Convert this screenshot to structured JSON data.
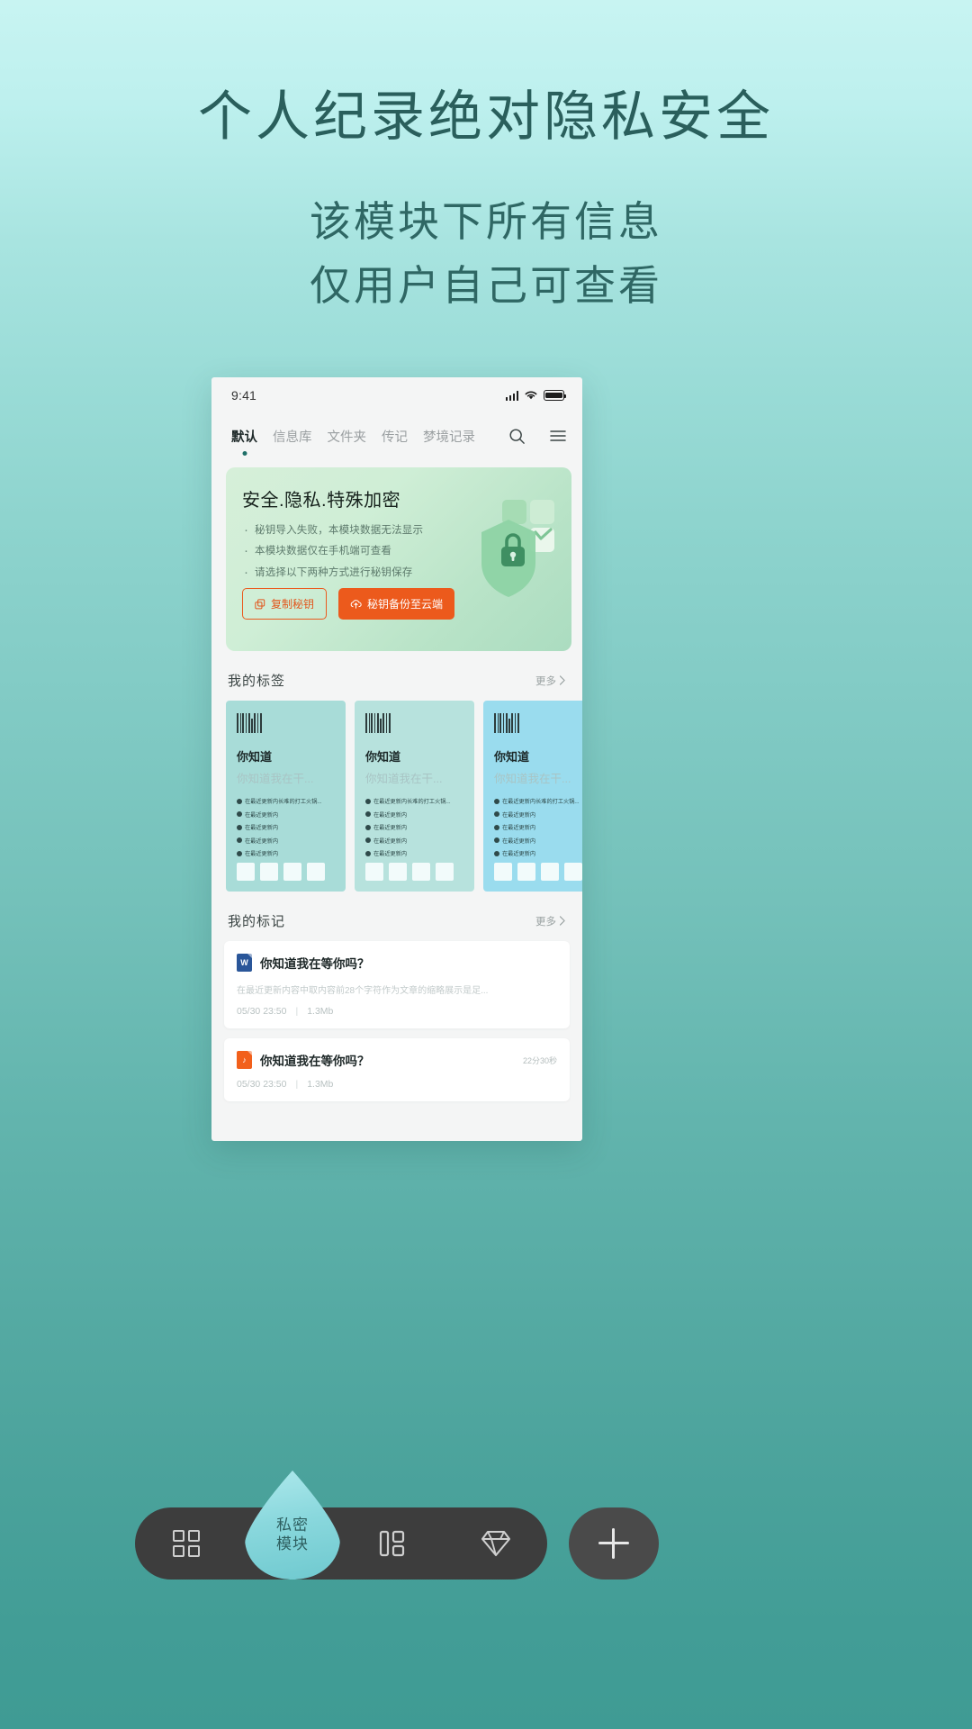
{
  "hero": {
    "title": "个人纪录绝对隐私安全",
    "subtitle_line1": "该模块下所有信息",
    "subtitle_line2": "仅用户自己可查看"
  },
  "phone": {
    "status": {
      "time": "9:41",
      "signal_icon": "signal-bars-icon",
      "wifi_icon": "wifi-icon",
      "battery_icon": "battery-icon"
    },
    "tabs": [
      {
        "label": "默认",
        "active": true
      },
      {
        "label": "信息库",
        "active": false
      },
      {
        "label": "文件夹",
        "active": false
      },
      {
        "label": "传记",
        "active": false
      },
      {
        "label": "梦境记录",
        "active": false
      }
    ],
    "tab_actions": {
      "search_icon": "search-icon",
      "menu_icon": "hamburger-menu-icon"
    },
    "encryption_card": {
      "title": "安全.隐私.特殊加密",
      "bullets": [
        "秘钥导入失败，本模块数据无法显示",
        "本模块数据仅在手机端可查看",
        "请选择以下两种方式进行秘钥保存"
      ],
      "copy_button": {
        "label": "复制秘钥",
        "icon": "copy-icon"
      },
      "backup_button": {
        "label": "秘钥备份至云端",
        "icon": "cloud-upload-icon"
      },
      "illustration": "shield-lock-icon",
      "accent_color": "#ec5a1c",
      "card_bg": "#cfeed6"
    },
    "tags_section": {
      "title": "我的标签",
      "more_label": "更多",
      "more_icon": "chevron-right-icon",
      "cards": [
        {
          "icon": "barcode-icon",
          "title": "你知道",
          "subtitle": "你知道我在干...",
          "bg": "#a8dcd8",
          "items": [
            "在最近更新内长难的打工火锅...",
            "在最近更新内",
            "在最近更新内",
            "在最近更新内",
            "在最近更新内"
          ]
        },
        {
          "icon": "barcode-icon",
          "title": "你知道",
          "subtitle": "你知道我在干...",
          "bg": "#b7e2dd",
          "items": [
            "在最近更新内长难的打工火锅...",
            "在最近更新内",
            "在最近更新内",
            "在最近更新内",
            "在最近更新内"
          ]
        },
        {
          "icon": "barcode-icon",
          "title": "你知道",
          "subtitle": "你知道我在干...",
          "bg": "#9adcee",
          "items": [
            "在最近更新内长难的打工火锅...",
            "在最近更新内",
            "在最近更新内",
            "在最近更新内",
            "在最近更新内"
          ]
        }
      ]
    },
    "marks_section": {
      "title": "我的标记",
      "more_label": "更多",
      "more_icon": "chevron-right-icon",
      "items": [
        {
          "file_icon": "word-document-icon",
          "file_type": "W",
          "title": "你知道我在等你吗？",
          "description": "在最近更新内容中取内容前28个字符作为文章的缩略展示是足...",
          "date": "05/30 23:50",
          "size": "1.3Mb",
          "duration": ""
        },
        {
          "file_icon": "audio-file-icon",
          "file_type": "♪",
          "title": "你知道我在等你吗？",
          "description": "",
          "date": "05/30 23:50",
          "size": "1.3Mb",
          "duration": "22分30秒"
        }
      ]
    }
  },
  "bottom_nav": {
    "items": [
      {
        "icon": "grid-squares-icon",
        "label": ""
      },
      {
        "icon": "layout-blocks-icon",
        "label": ""
      },
      {
        "icon": "diamond-icon",
        "label": ""
      }
    ],
    "center_button": {
      "label_line1": "私密",
      "label_line2": "模块",
      "icon": "droplet-icon"
    },
    "add_button": {
      "icon": "plus-icon"
    }
  }
}
